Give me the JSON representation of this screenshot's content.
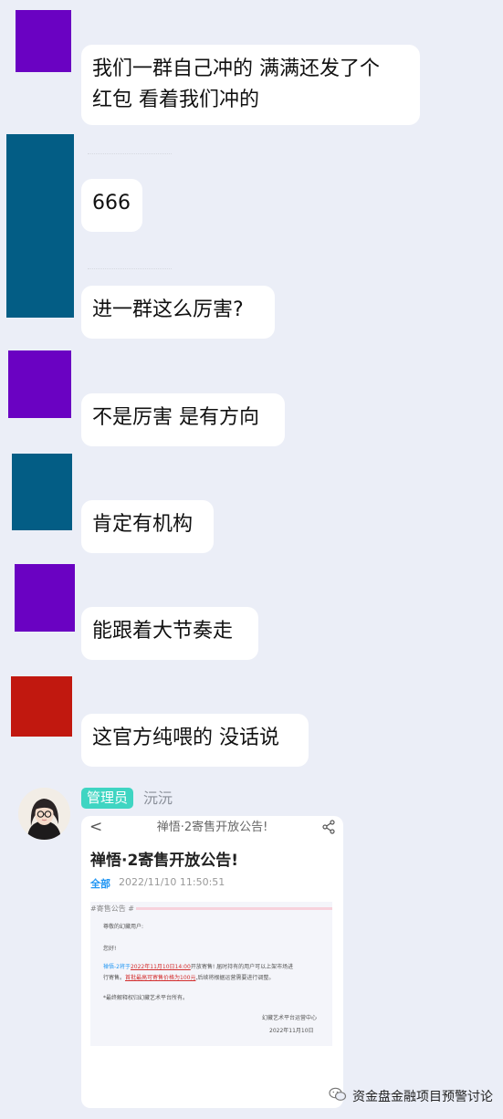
{
  "messages": [
    {
      "text": "我们一群自己冲的 满满还发了个\n红包 看着我们冲的",
      "avatar_color": "#6a02c2"
    },
    {
      "text": "666",
      "avatar_color": "#035d85"
    },
    {
      "text": "进一群这么厉害?",
      "avatar_color": "#035d85"
    },
    {
      "text": "不是厉害 是有方向",
      "avatar_color": "#6a02c2"
    },
    {
      "text": "肯定有机构",
      "avatar_color": "#035d85"
    },
    {
      "text": "能跟着大节奏走",
      "avatar_color": "#6a02c2"
    },
    {
      "text": "这官方纯喂的 没话说",
      "avatar_color": "#c1180f"
    }
  ],
  "admin": {
    "badge": "管理员",
    "name": "沅沅"
  },
  "card": {
    "header": "禅悟·2寄售开放公告!",
    "back": "<",
    "title": "禅悟·2寄售开放公告!",
    "category": "全部",
    "datetime": "2022/11/10 11:50:51",
    "tag": "#寄售公告 #",
    "greeting": "尊敬的幻藏用户:",
    "hello": "您好!",
    "body_1a": "禅悟-2将于",
    "body_1b": "2022年11月10日14:00",
    "body_1c": "开放寄售! 届时持有的用户可以上架市场进",
    "body_2a": "行寄售。",
    "body_2b": "首批最高可寄售价格为100元",
    "body_2c": ",后续将根据运营需要进行调整。",
    "note": "*最终解释权归幻藏艺术平台所有。",
    "sign": "幻藏艺术平台运营中心",
    "sign_date": "2022年11月10日"
  },
  "watermark": "资金盘金融项目预警讨论"
}
